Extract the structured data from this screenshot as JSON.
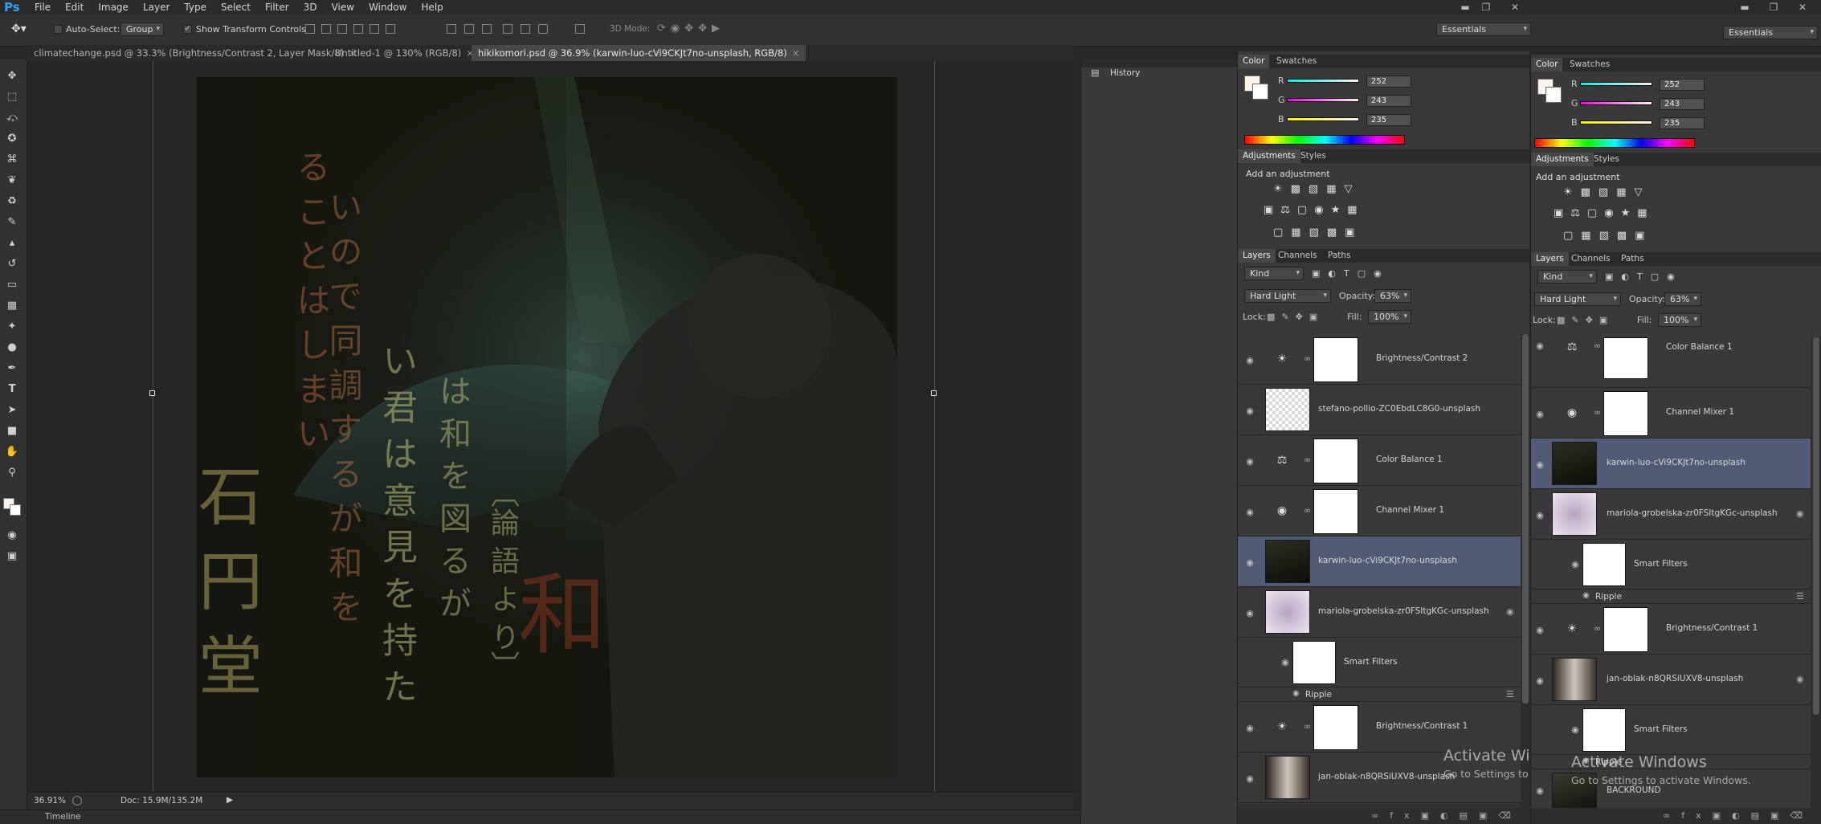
{
  "app": {
    "logo": "Ps"
  },
  "menu": [
    "File",
    "Edit",
    "Image",
    "Layer",
    "Type",
    "Select",
    "Filter",
    "3D",
    "View",
    "Window",
    "Help"
  ],
  "options": {
    "auto_select_label": "Auto-Select:",
    "auto_select_value": "Group",
    "show_transform_label": "Show Transform Controls",
    "mode3d_label": "3D Mode:",
    "workspace": "Essentials",
    "workspace2": "Essentials"
  },
  "tabs": [
    {
      "label": "climatechange.psd @ 33.3% (Brightness/Contrast 2, Layer Mask/8)",
      "close": "×"
    },
    {
      "label": "Untitled-1 @ 130% (RGB/8)",
      "close": "×"
    },
    {
      "label": "hikikomori.psd @ 36.9% (karwin-luo-cVi9CKJt7no-unsplash, RGB/8)",
      "close": "×"
    }
  ],
  "status": {
    "zoom": "36.91%",
    "doc": "Doc: 15.9M/135.2M"
  },
  "timeline": {
    "label": "Timeline"
  },
  "history": {
    "label": "History"
  },
  "colors": {
    "accent_select": "#515b77",
    "canvas_bg": "#262626",
    "panel_bg": "#393939"
  },
  "panelA": {
    "color_tabs": [
      "Color",
      "Swatches"
    ],
    "rgb": [
      {
        "ch": "R",
        "val": "252"
      },
      {
        "ch": "G",
        "val": "243"
      },
      {
        "ch": "B",
        "val": "235"
      }
    ],
    "adj_tabs": [
      "Adjustments",
      "Styles"
    ],
    "add_adjustment": "Add an adjustment",
    "layer_tabs": [
      "Layers",
      "Channels",
      "Paths"
    ],
    "kind": "Kind",
    "blend": "Hard Light",
    "opacity_label": "Opacity:",
    "opacity": "63%",
    "lock_label": "Lock:",
    "fill_label": "Fill:",
    "fill": "100%",
    "layers": [
      {
        "name": "Brightness/Contrast 2",
        "kind": "adj",
        "icon": "sun-icon"
      },
      {
        "name": "stefano-pollio-ZC0EbdLC8G0-unsplash",
        "kind": "img"
      },
      {
        "name": "Color Balance 1",
        "kind": "adj",
        "icon": "balance-icon"
      },
      {
        "name": "Channel Mixer 1",
        "kind": "adj",
        "icon": "mixer-icon"
      },
      {
        "name": "karwin-luo-cVi9CKJt7no-unsplash",
        "kind": "img",
        "selected": true
      },
      {
        "name": "mariola-grobelska-zr0FSItgKGc-unsplash",
        "kind": "img"
      },
      {
        "name": "Smart Filters",
        "kind": "filter"
      },
      {
        "name": "Ripple",
        "kind": "filterItem"
      },
      {
        "name": "Brightness/Contrast 1",
        "kind": "adj",
        "icon": "sun-icon"
      },
      {
        "name": "jan-oblak-n8QRSiUXV8-unsplash",
        "kind": "img"
      }
    ]
  },
  "panelB": {
    "color_tabs": [
      "Color",
      "Swatches"
    ],
    "rgb": [
      {
        "ch": "R",
        "val": "252"
      },
      {
        "ch": "G",
        "val": "243"
      },
      {
        "ch": "B",
        "val": "235"
      }
    ],
    "adj_tabs": [
      "Adjustments",
      "Styles"
    ],
    "add_adjustment": "Add an adjustment",
    "layer_tabs": [
      "Layers",
      "Channels",
      "Paths"
    ],
    "kind": "Kind",
    "blend": "Hard Light",
    "opacity_label": "Opacity:",
    "opacity": "63%",
    "lock_label": "Lock:",
    "fill_label": "Fill:",
    "fill": "100%",
    "layers": [
      {
        "name": "Color Balance 1"
      },
      {
        "name": "Channel Mixer 1"
      },
      {
        "name": "karwin-luo-cVi9CKJt7no-unsplash"
      },
      {
        "name": "mariola-grobelska-zr0FSItgKGc-unsplash"
      },
      {
        "name": "Smart Filters"
      },
      {
        "name": "Ripple"
      },
      {
        "name": "Brightness/Contrast 1"
      },
      {
        "name": "jan-oblak-n8QRSiUXV8-unsplash"
      },
      {
        "name": "Smart Filters"
      },
      {
        "name": "Ripple"
      },
      {
        "name": "BACKROUND"
      }
    ]
  },
  "watermark": {
    "title": "Activate Windows",
    "sub": "Go to Settings to activate Windows."
  },
  "canvas_text": {
    "col1": "る こ と は し ま い",
    "col2": "い の で 同 調 す る が 和 を",
    "col3": "い 君 は 意 見 を 持 た",
    "col4": "は 和 を 図 る が",
    "col5": "〔論 語 よ り〕",
    "big1": "和",
    "big2": "石 円 堂"
  }
}
